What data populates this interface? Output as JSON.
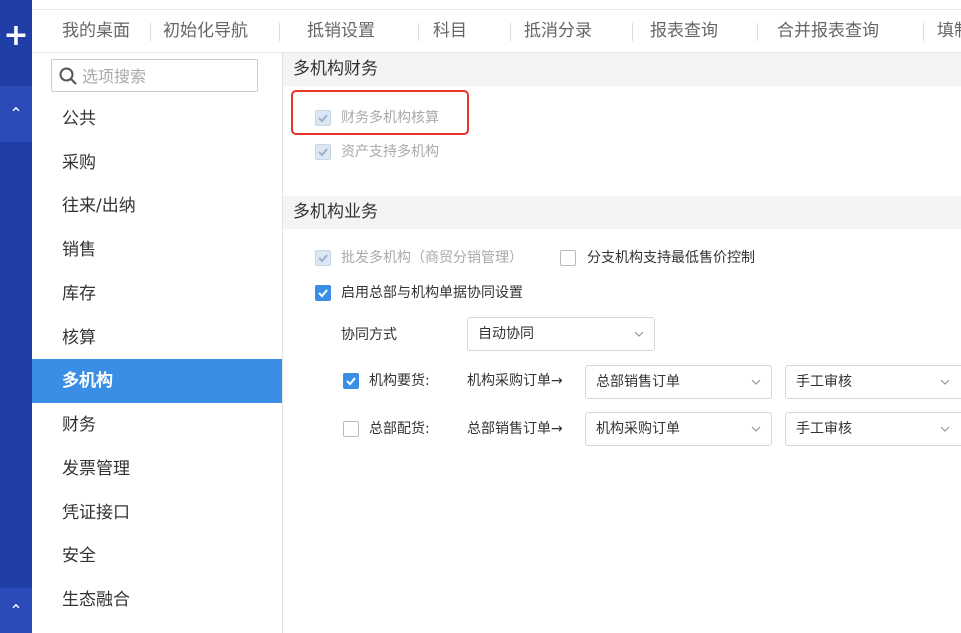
{
  "tabs": [
    "我的桌面",
    "初始化导航",
    "抵销设置",
    "科目",
    "抵消分录",
    "报表查询",
    "合并报表查询",
    "填制"
  ],
  "sidebar": {
    "search_placeholder": "选项搜索",
    "items": [
      "公共",
      "采购",
      "往来/出纳",
      "销售",
      "库存",
      "核算",
      "多机构",
      "财务",
      "发票管理",
      "凭证接口",
      "安全",
      "生态融合"
    ],
    "active": "多机构"
  },
  "finance_section": {
    "title": "多机构财务",
    "opt1": "财务多机构核算",
    "opt2": "资产支持多机构"
  },
  "business_section": {
    "title": "多机构业务",
    "wholesale": "批发多机构（商贸分销管理）",
    "branch_min_price": "分支机构支持最低售价控制",
    "enable_collab": "启用总部与机构单据协同设置",
    "collab_mode_label": "协同方式",
    "collab_mode_value": "自动协同",
    "row1": {
      "label": "机构要货:",
      "flow": "机构采购订单→",
      "target": "总部销售订单",
      "audit": "手工审核"
    },
    "row2": {
      "label": "总部配货:",
      "flow": "总部销售订单→",
      "target": "机构采购订单",
      "audit": "手工审核"
    }
  },
  "colors": {
    "rail": "#1f3fa6",
    "accent": "#3a8ee6",
    "highlight": "#e8332a"
  }
}
